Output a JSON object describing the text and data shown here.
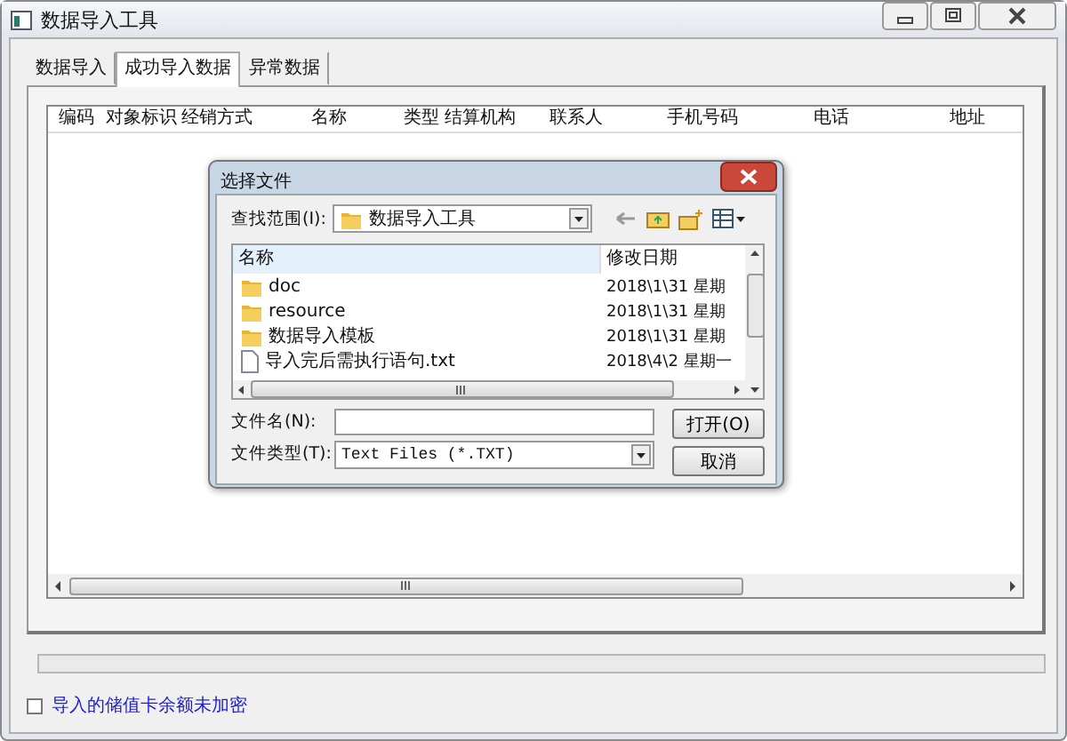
{
  "window": {
    "title": "数据导入工具"
  },
  "tabs": [
    {
      "label": "数据导入",
      "selected": false
    },
    {
      "label": "成功导入数据",
      "selected": true
    },
    {
      "label": "异常数据",
      "selected": false
    }
  ],
  "table": {
    "columns": [
      "编码",
      "对象标识",
      "经销方式",
      "名称",
      "类型",
      "结算机构",
      "联系人",
      "手机号码",
      "电话",
      "地址"
    ]
  },
  "progress": {
    "level": 0
  },
  "option": {
    "label": "导入的储值卡余额未加密",
    "checked": false
  },
  "dialog": {
    "title": "选择文件",
    "look_in": {
      "label": "查找范围(I):",
      "value": "数据导入工具"
    },
    "file_list": {
      "columns": [
        "名称",
        "修改日期"
      ],
      "rows": [
        {
          "kind": "folder",
          "name": "doc",
          "date": "2018\\1\\31 星期"
        },
        {
          "kind": "folder",
          "name": "resource",
          "date": "2018\\1\\31 星期"
        },
        {
          "kind": "folder",
          "name": "数据导入模板",
          "date": "2018\\1\\31 星期"
        },
        {
          "kind": "file",
          "name": "导入完后需执行语句.txt",
          "date": "2018\\4\\2 星期一"
        }
      ]
    },
    "file_name": {
      "label": "文件名(N):"
    },
    "file_type": {
      "label": "文件类型(T):",
      "value": "Text Files (*.TXT)"
    },
    "buttons": [
      "打开(O)",
      "取消"
    ]
  }
}
